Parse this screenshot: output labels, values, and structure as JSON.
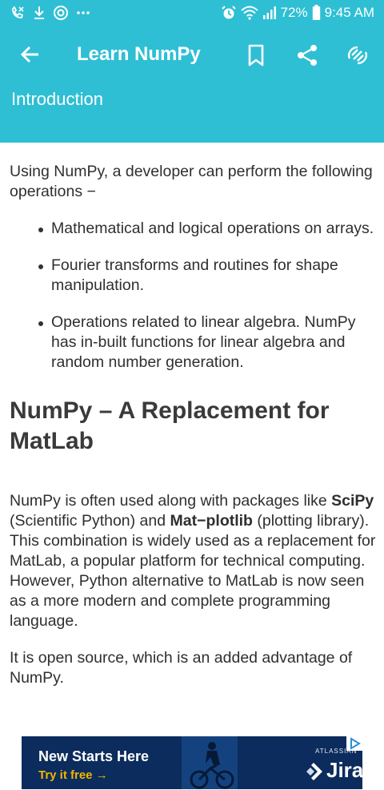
{
  "status_bar": {
    "battery": "72%",
    "time": "9:45 AM",
    "icons": [
      "missed-call-icon",
      "download-icon",
      "app-icon",
      "more-icon",
      "alarm-icon",
      "wifi-icon",
      "signal-icon",
      "battery-icon"
    ]
  },
  "app_bar": {
    "title": "Learn NumPy",
    "section": "Introduction",
    "icons": [
      "back-arrow-icon",
      "bookmark-icon",
      "share-icon",
      "cast-icon"
    ],
    "color": "#2ebfd4"
  },
  "content": {
    "intro": "Using NumPy, a developer can perform the following operations −",
    "bullets": [
      "Mathematical and logical operations on arrays.",
      "Fourier transforms and routines for shape manipulation.",
      "Operations related to linear algebra. NumPy has in-built functions for linear algebra and random number generation."
    ],
    "heading": "NumPy – A Replacement for MatLab",
    "paragraph": {
      "t1": "NumPy is often used along with packages like ",
      "b1": "SciPy",
      "t2": " (Scientific Python) and ",
      "b2": "Mat−plotlib",
      "t3": " (plotting library). This combination is widely used as a replacement for MatLab, a popular platform for technical computing. However, Python alternative to MatLab is now seen as a more modern and complete programming language."
    },
    "closing": "It is open source, which is an added advantage of NumPy."
  },
  "ad": {
    "headline": "New Starts Here",
    "cta": "Try it free",
    "brand_small": "ATLASSIAN",
    "brand": "Jira",
    "background": "#0b2c5c",
    "cta_color": "#f5b400"
  }
}
